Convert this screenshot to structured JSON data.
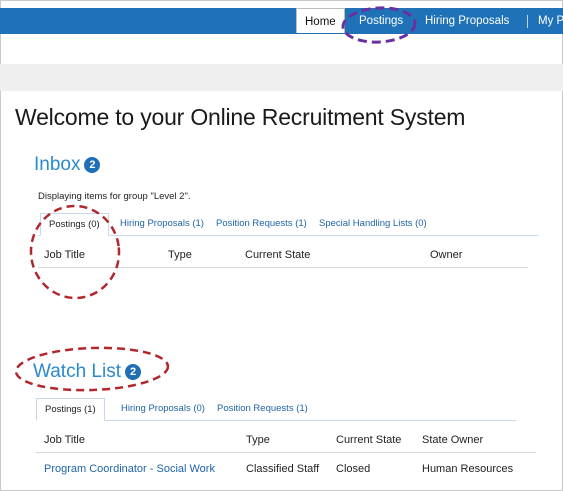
{
  "nav": {
    "items": [
      {
        "label": "Home",
        "active": true
      },
      {
        "label": "Postings",
        "active": false
      },
      {
        "label": "Hiring Proposals",
        "active": false
      },
      {
        "label": "My P",
        "active": false
      }
    ]
  },
  "page_title": "Welcome to your Online Recruitment System",
  "inbox": {
    "title": "Inbox",
    "badge": "2",
    "group_note": "Displaying items for group \"Level 2\".",
    "tabs": [
      "Postings (0)",
      "Hiring Proposals (1)",
      "Position Requests (1)",
      "Special Handling Lists (0)"
    ],
    "columns": [
      "Job Title",
      "Type",
      "Current State",
      "Owner"
    ]
  },
  "watch_list": {
    "title": "Watch List",
    "badge": "2",
    "tabs": [
      "Postings (1)",
      "Hiring Proposals (0)",
      "Position Requests (1)"
    ],
    "columns": [
      "Job Title",
      "Type",
      "Current State",
      "State Owner"
    ],
    "rows": [
      {
        "job_title": "Program Coordinator - Social Work",
        "type": "Classified Staff",
        "current_state": "Closed",
        "state_owner": "Human Resources"
      }
    ]
  },
  "colors": {
    "nav_blue": "#1f72b8",
    "link_blue": "#1f64a8",
    "heading_blue": "#2a8ad0",
    "annotation_red": "#b0282e",
    "annotation_purple": "#6a2fa0"
  }
}
